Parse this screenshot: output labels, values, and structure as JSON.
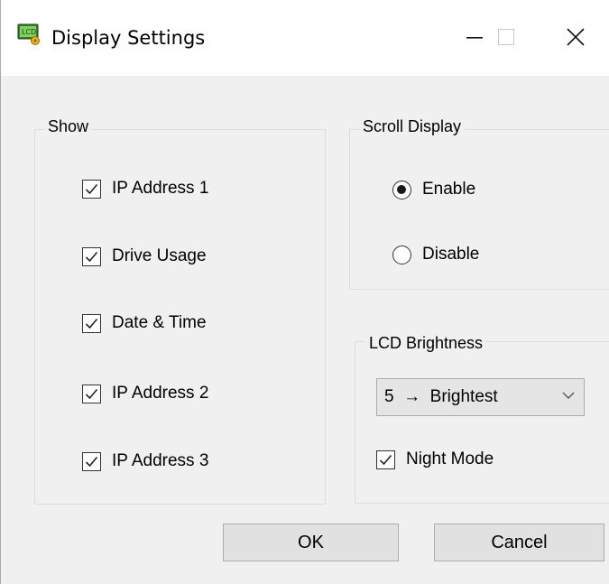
{
  "window": {
    "title": "Display Settings",
    "app_icon": "lcd-app-icon"
  },
  "titlebar_buttons": {
    "minimize": "minimize-icon",
    "maximize": "maximize-icon",
    "close": "close-icon"
  },
  "show_group": {
    "legend": "Show",
    "items": [
      {
        "label": "IP Address 1",
        "checked": true
      },
      {
        "label": "Drive Usage",
        "checked": true
      },
      {
        "label": "Date & Time",
        "checked": true
      },
      {
        "label": "IP Address 2",
        "checked": true
      },
      {
        "label": "IP Address 3",
        "checked": true
      }
    ]
  },
  "scroll_group": {
    "legend": "Scroll Display",
    "options": [
      {
        "label": "Enable",
        "selected": true
      },
      {
        "label": "Disable",
        "selected": false
      }
    ]
  },
  "brightness_group": {
    "legend": "LCD Brightness",
    "selected_value": "5  →  Brightest",
    "night_mode": {
      "label": "Night Mode",
      "checked": true
    }
  },
  "buttons": {
    "ok": "OK",
    "cancel": "Cancel"
  }
}
